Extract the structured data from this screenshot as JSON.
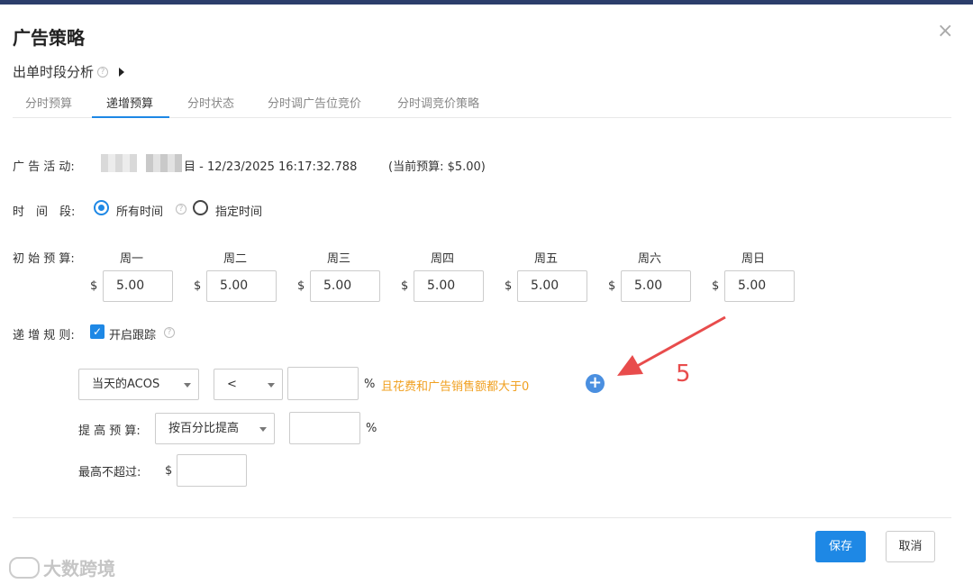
{
  "dialog": {
    "title": "广告策略",
    "close_glyph": "×",
    "subtitle": "出单时段分析",
    "help_glyph": "?"
  },
  "tabs": [
    {
      "label": "分时预算",
      "active": false
    },
    {
      "label": "递增预算",
      "active": true
    },
    {
      "label": "分时状态",
      "active": false
    },
    {
      "label": "分时调广告位竞价",
      "active": false
    },
    {
      "label": "分时调竞价策略",
      "active": false
    }
  ],
  "campaign": {
    "label": "广 告 活 动:",
    "name_suffix": "目 - 12/23/2025 16:17:32.788",
    "budget": "(当前预算: $5.00)"
  },
  "time_period": {
    "label": "时　间　段:",
    "options": [
      {
        "label": "所有时间",
        "selected": true
      },
      {
        "label": "指定时间",
        "selected": false
      }
    ]
  },
  "initial_budget": {
    "label": "初 始 预 算:",
    "currency": "$",
    "days": [
      {
        "day": "周一",
        "value": "5.00"
      },
      {
        "day": "周二",
        "value": "5.00"
      },
      {
        "day": "周三",
        "value": "5.00"
      },
      {
        "day": "周四",
        "value": "5.00"
      },
      {
        "day": "周五",
        "value": "5.00"
      },
      {
        "day": "周六",
        "value": "5.00"
      },
      {
        "day": "周日",
        "value": "5.00"
      }
    ]
  },
  "rule": {
    "label": "递 增 规 则:",
    "check_glyph": "✓",
    "checkbox_label": "开启跟踪",
    "checked": true,
    "metric": "当天的ACOS",
    "operator": "<",
    "threshold": "",
    "percent": "%",
    "condition_note": "且花费和广告销售额都大于0",
    "add_glyph": "+",
    "increase_label": "提 高 预 算:",
    "increase_method": "按百分比提高",
    "increase_value": "",
    "max_label": "最高不超过:",
    "max_currency": "$",
    "max_value": ""
  },
  "annotation": {
    "number": "5",
    "color": "#e84c4c"
  },
  "footer": {
    "save_label": "保存",
    "cancel_label": "取消"
  },
  "watermark": {
    "text": "大数跨境"
  },
  "colors": {
    "accent": "#1e88e5",
    "warning": "#f0a020"
  }
}
